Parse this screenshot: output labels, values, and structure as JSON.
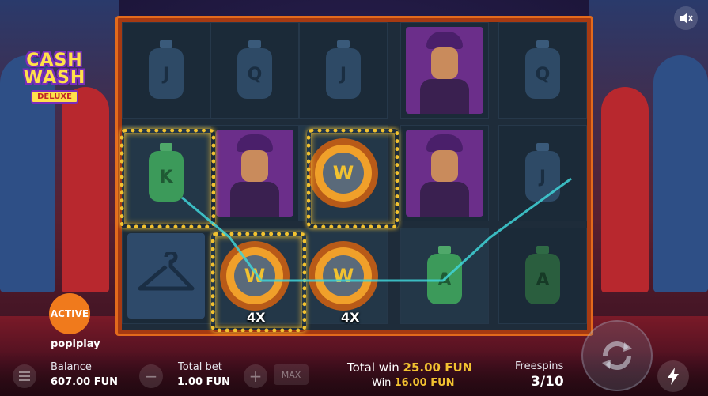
{
  "logo": {
    "line1": "CASH",
    "line2": "WASH",
    "badge": "DELUXE"
  },
  "mute": {
    "icon": "speaker-mute-icon"
  },
  "status_badge": "ACTIVE",
  "provider": "popiplay",
  "grid": {
    "rows": [
      [
        "J-bottle",
        "Q-bottle",
        "J-bottle",
        "gangster",
        "Q-bottle"
      ],
      [
        "K-bottle",
        "gangster",
        "W-wild",
        "gangster",
        "J-bottle"
      ],
      [
        "hanger",
        "W-wild-4x",
        "W-wild-4x",
        "A-bottle",
        "A-bottle"
      ]
    ],
    "letters": {
      "r0c0": "J",
      "r0c1": "Q",
      "r0c2": "J",
      "r0c4": "Q",
      "r1c0": "K",
      "r1c4": "J",
      "r2c3": "A",
      "r2c4": "A",
      "r1c2": "W",
      "r2c1": "W",
      "r2c2": "W"
    },
    "multipliers": {
      "r2c1": "4X",
      "r2c2": "4X"
    }
  },
  "bottom_bar": {
    "balance_label": "Balance",
    "balance_value": "607.00 FUN",
    "total_bet_label": "Total bet",
    "total_bet_value": "1.00 FUN",
    "max_label": "MAX",
    "total_win_label": "Total win",
    "total_win_value": "25.00 FUN",
    "win_label": "Win",
    "win_value": "16.00 FUN",
    "freespins_label": "Freespins",
    "freespins_value": "3/10"
  },
  "colors": {
    "accent": "#f2c230",
    "frame": "#e36a1c",
    "win_text": "#f2c230",
    "active": "#f07a1c"
  }
}
